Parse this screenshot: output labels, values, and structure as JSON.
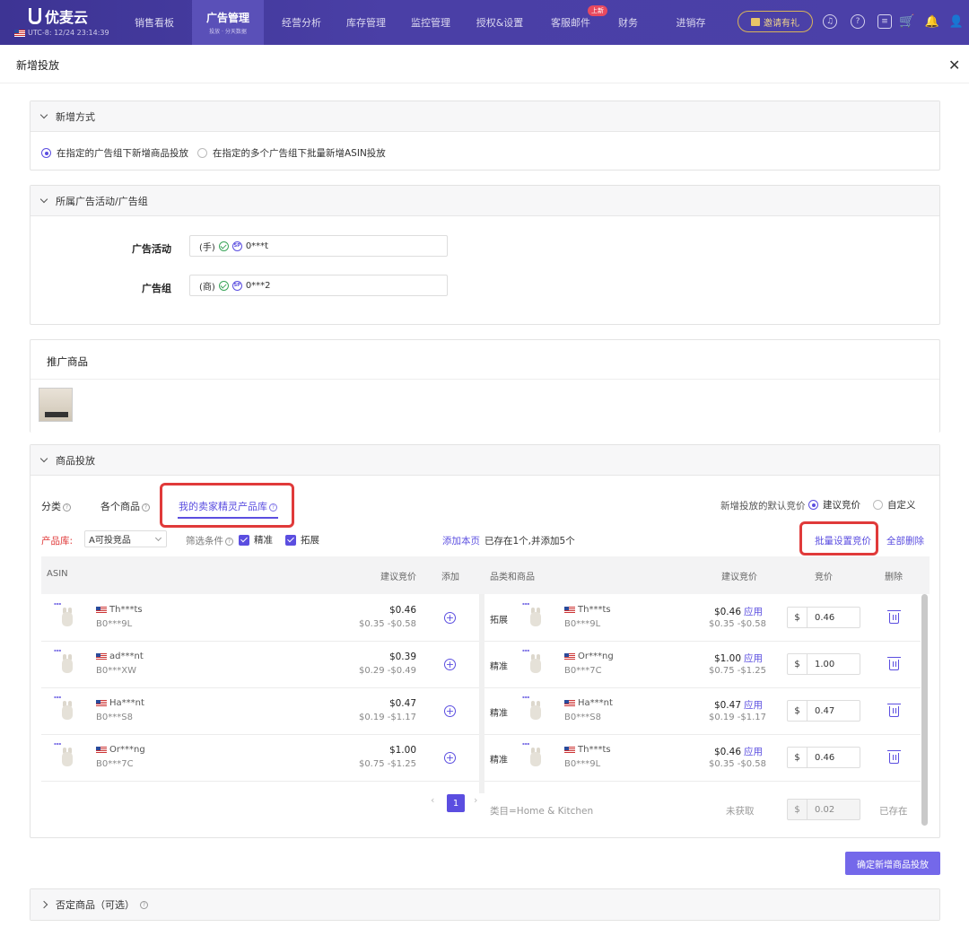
{
  "app": {
    "logo": "优麦云",
    "store": "UTC-8: 12/24 23:14:39"
  },
  "nav": {
    "items": [
      "销售看板",
      "广告管理",
      "经营分析",
      "库存管理",
      "监控管理",
      "授权&设置",
      "客服邮件",
      "财务",
      "进销存"
    ],
    "active_sub": "投放 · 分天数据",
    "new_badge": "上新",
    "invite": "邀请有礼"
  },
  "drawer": {
    "title": "新增投放",
    "close": "✕"
  },
  "add_method": {
    "title": "新增方式",
    "option1": "在指定的广告组下新增商品投放",
    "option2": "在指定的多个广告组下批量新增ASIN投放"
  },
  "campaign": {
    "title": "所属广告活动/广告组",
    "campaign_label": "广告活动",
    "campaign_prefix": "(手)",
    "campaign_value": "0***t",
    "group_label": "广告组",
    "group_prefix": "(商)",
    "group_value": "0***2",
    "sp": "SP"
  },
  "promoted": {
    "title": "推广商品"
  },
  "targeting": {
    "title": "商品投放",
    "tabs": [
      "分类",
      "各个商品",
      "我的卖家精灵产品库"
    ],
    "default_bid_label": "新增投放的默认竞价",
    "bid_opt1": "建议竞价",
    "bid_opt2": "自定义",
    "library_label": "产品库:",
    "library_value": "A可投竞品",
    "filter_label": "筛选条件",
    "filter_exact": "精准",
    "filter_expand": "拓展",
    "add_page": "添加本页",
    "exists_note": "已存在1个,并添加5个",
    "batch_bid": "批量设置竞价",
    "delete_all": "全部删除"
  },
  "left_table": {
    "headers": [
      "ASIN",
      "建议竞价",
      "添加"
    ],
    "rows": [
      {
        "name": "Th***ts",
        "asin": "B0***9L",
        "price": "$0.46",
        "range": "$0.35 -$0.58"
      },
      {
        "name": "ad***nt",
        "asin": "B0***XW",
        "price": "$0.39",
        "range": "$0.29 -$0.49"
      },
      {
        "name": "Ha***nt",
        "asin": "B0***S8",
        "price": "$0.47",
        "range": "$0.19 -$1.17"
      },
      {
        "name": "Or***ng",
        "asin": "B0***7C",
        "price": "$1.00",
        "range": "$0.75 -$1.25"
      }
    ]
  },
  "right_table": {
    "headers": [
      "品类和商品",
      "建议竞价",
      "竞价",
      "删除"
    ],
    "apply": "应用",
    "currency": "$",
    "rows": [
      {
        "type": "拓展",
        "name": "Th***ts",
        "asin": "B0***9L",
        "price": "$0.46",
        "range": "$0.35 -$0.58",
        "bid": "0.46"
      },
      {
        "type": "精准",
        "name": "Or***ng",
        "asin": "B0***7C",
        "price": "$1.00",
        "range": "$0.75 -$1.25",
        "bid": "1.00"
      },
      {
        "type": "精准",
        "name": "Ha***nt",
        "asin": "B0***S8",
        "price": "$0.47",
        "range": "$0.19 -$1.17",
        "bid": "0.47"
      },
      {
        "type": "精准",
        "name": "Th***ts",
        "asin": "B0***9L",
        "price": "$0.46",
        "range": "$0.35 -$0.58",
        "bid": "0.46"
      }
    ],
    "category_row": {
      "label": "类目=Home & Kitchen",
      "status": "未获取",
      "bid": "0.02",
      "exists": "已存在"
    }
  },
  "pager": {
    "prev": "‹",
    "current": "1",
    "next": "›"
  },
  "confirm": "确定新增商品投放",
  "negative": {
    "title": "否定商品（可选）"
  },
  "icons": {
    "question": "?"
  },
  "colors": {
    "primary": "#5b4ee0",
    "nav_bg": "#4a3fa6",
    "highlight": "#e03a3a"
  }
}
